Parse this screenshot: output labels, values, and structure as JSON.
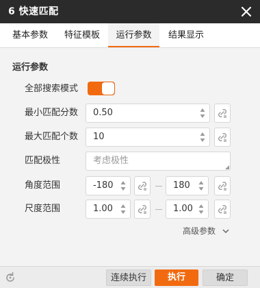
{
  "window": {
    "title": "6 快速匹配"
  },
  "tabs": [
    {
      "label": "基本参数"
    },
    {
      "label": "特征模板"
    },
    {
      "label": "运行参数"
    },
    {
      "label": "结果显示"
    }
  ],
  "section": {
    "title": "运行参数"
  },
  "params": {
    "search_all_mode": {
      "label": "全部搜索模式",
      "enabled": true
    },
    "min_match_score": {
      "label": "最小匹配分数",
      "value": "0.50"
    },
    "max_match_count": {
      "label": "最大匹配个数",
      "value": "10"
    },
    "match_polarity": {
      "label": "匹配极性",
      "placeholder": "考虑极性"
    },
    "angle_range": {
      "label": "角度范围",
      "min": "-180",
      "max": "180"
    },
    "scale_range": {
      "label": "尺度范围",
      "min": "1.00",
      "max": "1.00"
    }
  },
  "advanced": {
    "label": "高级参数"
  },
  "footer": {
    "continuous_run": "连续执行",
    "run": "执行",
    "confirm": "确定"
  },
  "colors": {
    "accent": "#f26a10",
    "titlebar": "#2b2b2b"
  },
  "icons": [
    "close-icon",
    "link-icon",
    "spin-arrows-icon",
    "chevron-down-icon",
    "reset-icon"
  ]
}
